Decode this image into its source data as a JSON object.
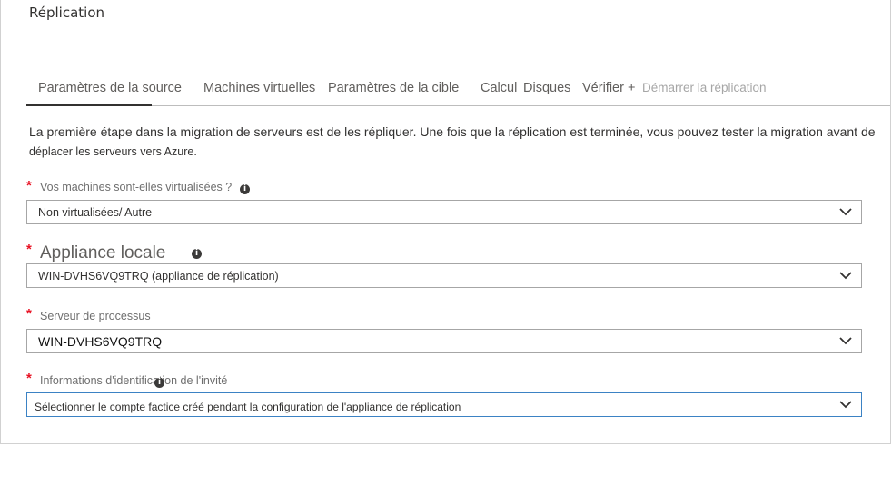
{
  "header": {
    "title": "Réplication"
  },
  "tabs": [
    {
      "label": "Paramètres de la source",
      "active": true
    },
    {
      "label": "Machines virtuelles"
    },
    {
      "label": "Paramètres de la cible"
    },
    {
      "label": "Calcul"
    },
    {
      "label": "Disques"
    },
    {
      "label": "Vérifier +"
    },
    {
      "label": "Démarrer la réplication",
      "disabled": true
    }
  ],
  "intro": {
    "line1": "La première étape dans la migration de serveurs est de les répliquer. Une fois que la réplication est terminée, vous pouvez tester la migration avant de",
    "line2": "déplacer les serveurs vers Azure."
  },
  "form": {
    "required_mark": "*",
    "info_glyph": "i",
    "virtualized": {
      "label": "Vos machines sont-elles virtualisées ?",
      "value": "Non virtualisées/   Autre"
    },
    "appliance": {
      "label": "Appliance locale",
      "value": "WIN-DVHS6VQ9TRQ  (appliance  de  réplication)"
    },
    "process_server": {
      "label": "Serveur de processus",
      "value": "WIN-DVHS6VQ9TRQ"
    },
    "guest_credentials": {
      "label": "Informations d'identification de l'invité",
      "value": "Sélectionner le compte factice créé pendant la configuration de l'appliance de réplication"
    }
  },
  "colors": {
    "required": "#e81123",
    "focus_border": "#3b82c4",
    "active_tab_underline": "#323130"
  }
}
